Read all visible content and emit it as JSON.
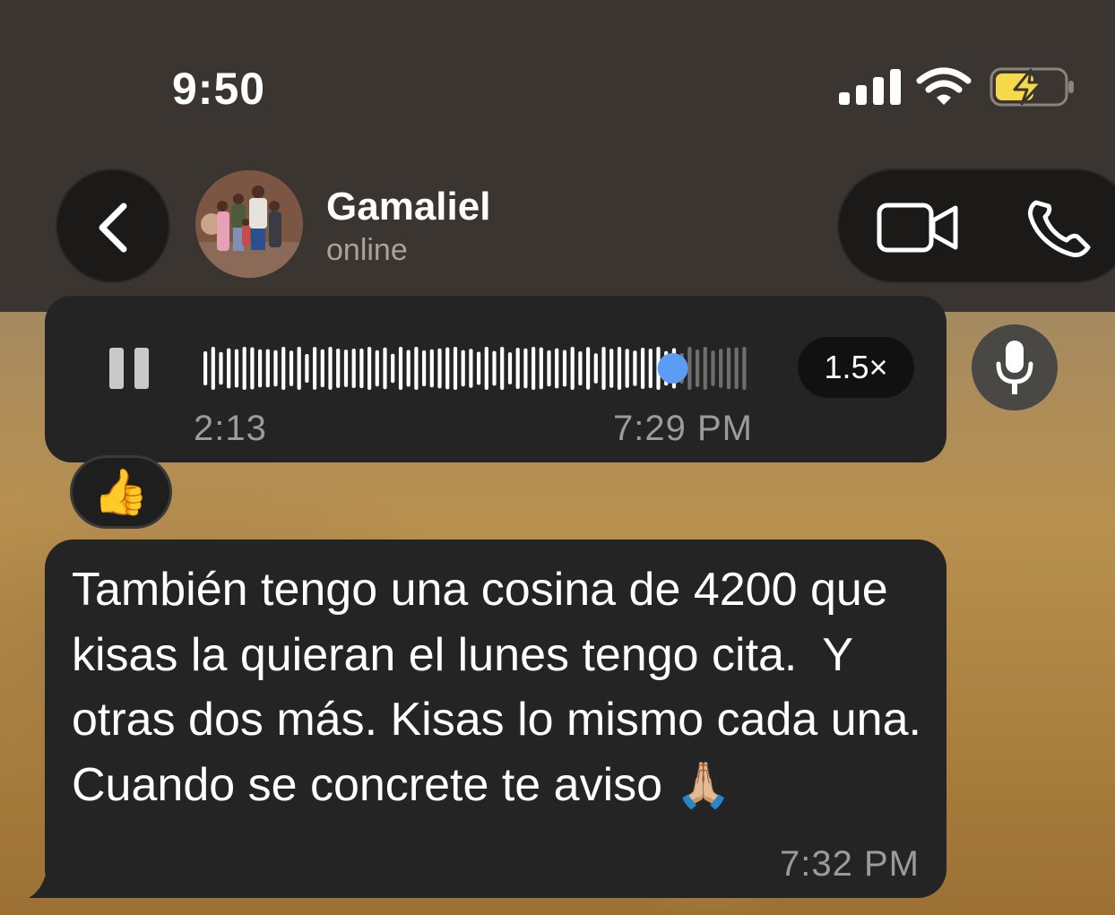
{
  "status_bar": {
    "time": "9:50"
  },
  "header": {
    "contact_name": "Gamaliel",
    "contact_status": "online"
  },
  "voice_message": {
    "duration": "2:13",
    "timestamp": "7:29 PM",
    "speed": "1.5×",
    "progress": 0.86
  },
  "reaction": {
    "emoji": "👍"
  },
  "text_message": {
    "body": "También tengo una cosina de 4200 que kisas la quieran el lunes tengo cita.  Y otras dos más. Kisas lo mismo cada una. Cuando se concrete te aviso",
    "emoji": "🙏🏼",
    "timestamp": "7:32 PM"
  },
  "colors": {
    "header_bg": "#3b3531",
    "bubble_bg": "#242424",
    "playhead": "#5b9cf5",
    "battery_fill": "#f5d94a"
  }
}
